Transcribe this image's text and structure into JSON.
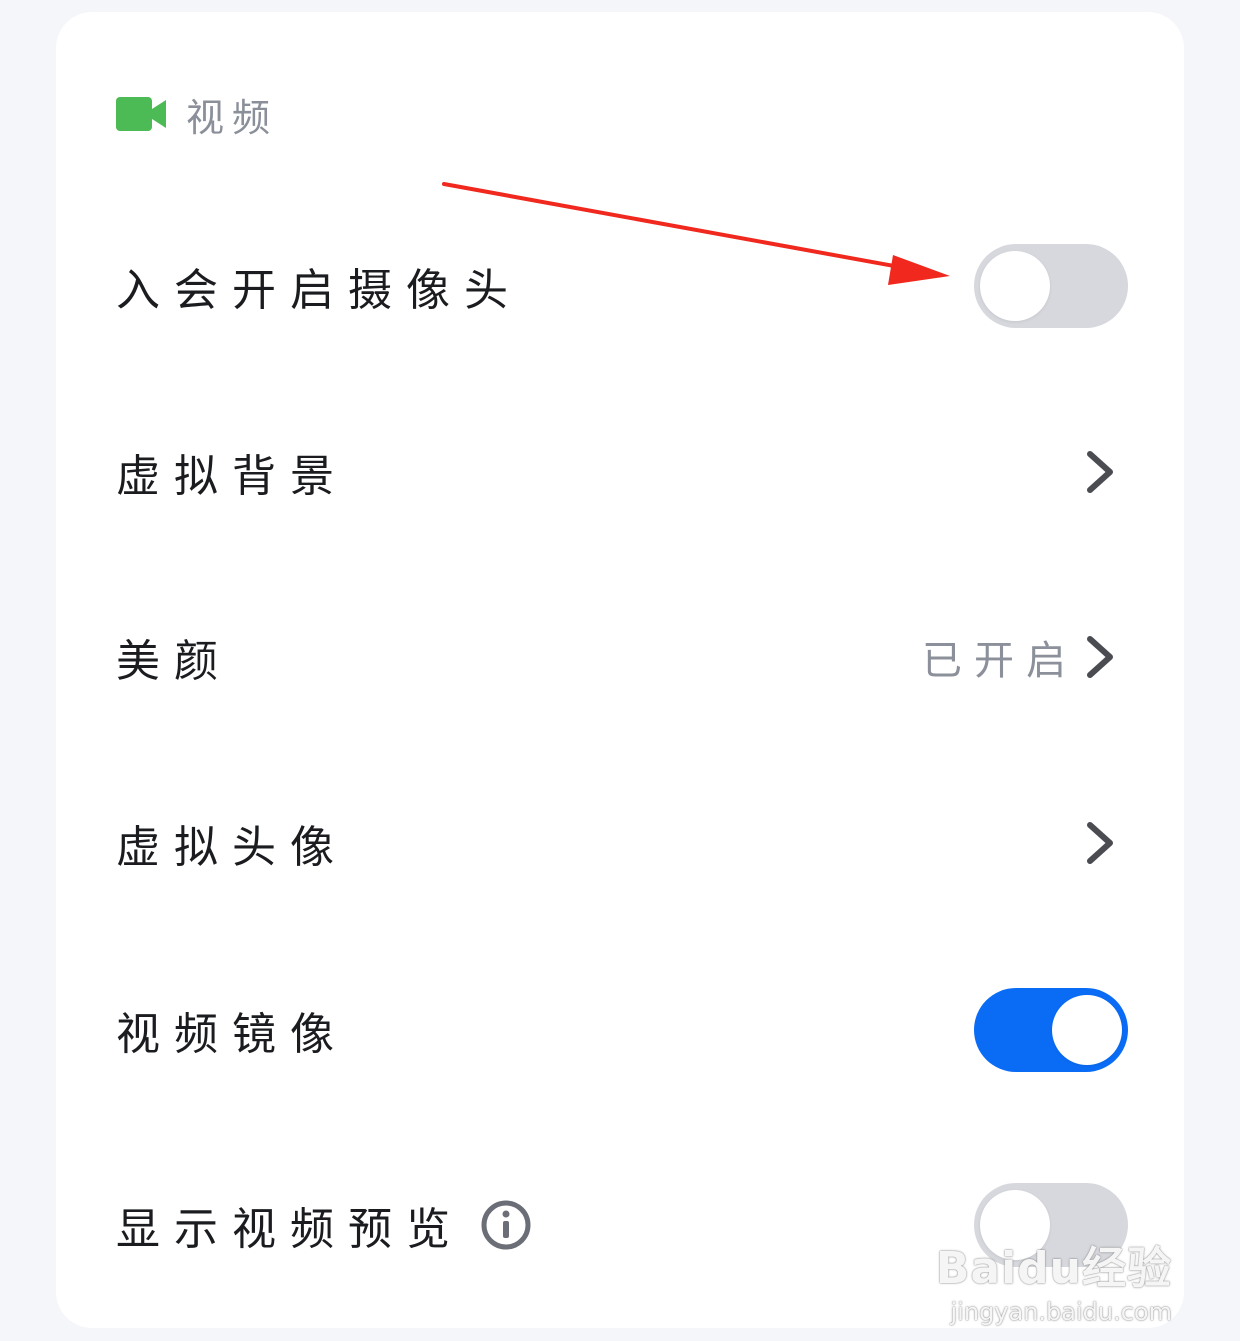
{
  "section": {
    "title": "视频",
    "icon": "video-camera-icon",
    "icon_color": "#4cbb55"
  },
  "rows": [
    {
      "label": "入会开启摄像头",
      "control": "toggle",
      "state": "off"
    },
    {
      "label": "虚拟背景",
      "control": "chevron"
    },
    {
      "label": "美颜",
      "control": "chevron",
      "value": "已开启"
    },
    {
      "label": "虚拟头像",
      "control": "chevron"
    },
    {
      "label": "视频镜像",
      "control": "toggle",
      "state": "on"
    },
    {
      "label": "显示视频预览",
      "control": "toggle",
      "state": "off",
      "extra_icon": "info-icon"
    }
  ],
  "colors": {
    "toggle_on": "#0a6cf5",
    "toggle_off": "#d6d8dd",
    "annotation_arrow": "#f0281e"
  },
  "watermark": {
    "logo": "Baidu经验",
    "url": "jingyan.baidu.com"
  }
}
